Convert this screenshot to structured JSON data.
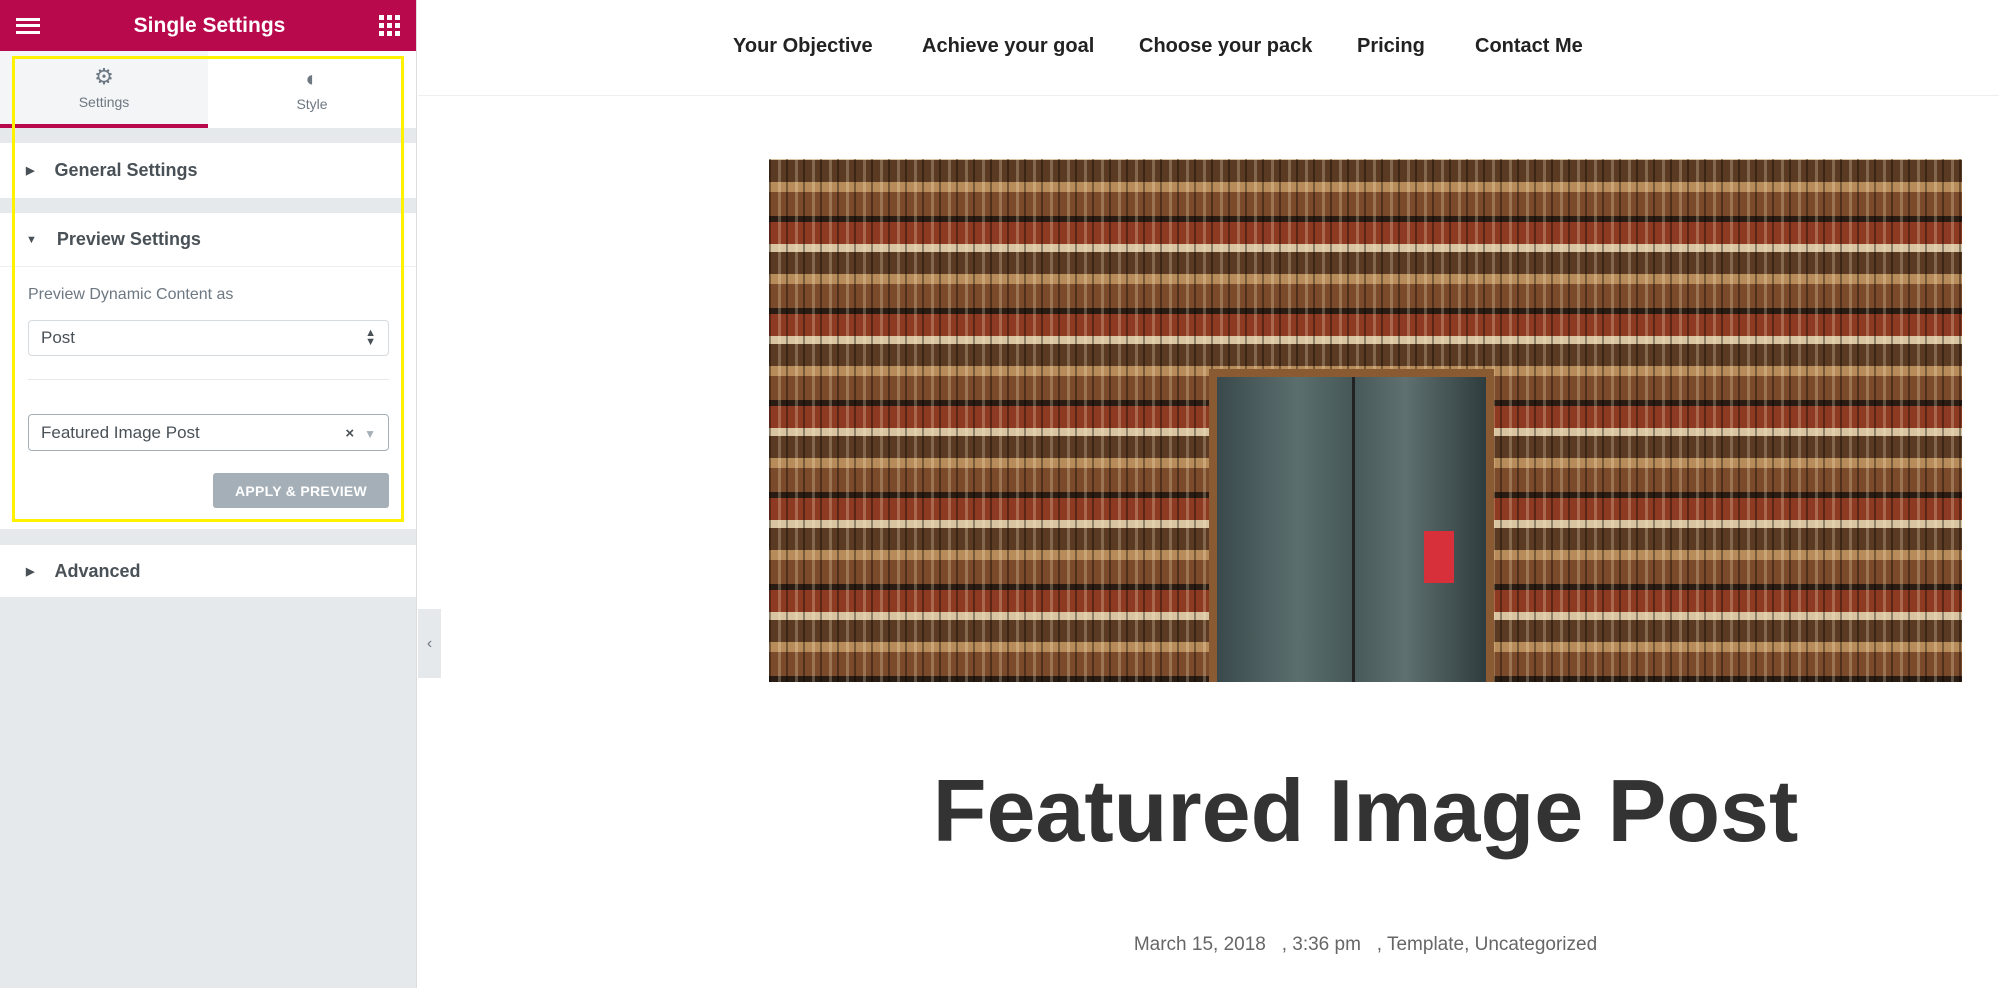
{
  "sidebar": {
    "title": "Single Settings",
    "tabs": [
      {
        "label": "Settings",
        "icon": "gear-icon"
      },
      {
        "label": "Style",
        "icon": "half-circle-icon"
      }
    ],
    "sections": {
      "general": "General Settings",
      "preview": "Preview Settings",
      "advanced": "Advanced"
    },
    "preview": {
      "label": "Preview Dynamic Content as",
      "type_value": "Post",
      "post_value": "Featured Image Post",
      "apply_label": "APPLY & PREVIEW"
    },
    "colors": {
      "brand": "#b7094c",
      "highlight": "#fff200"
    }
  },
  "nav": {
    "items": [
      "Your Objective",
      "Achieve your goal",
      "Choose your pack",
      "Pricing",
      "Contact Me"
    ]
  },
  "post": {
    "title": "Featured Image Post",
    "date": "March 15, 2018",
    "time": ", 3:36 pm",
    "categories": ", Template, Uncategorized"
  }
}
